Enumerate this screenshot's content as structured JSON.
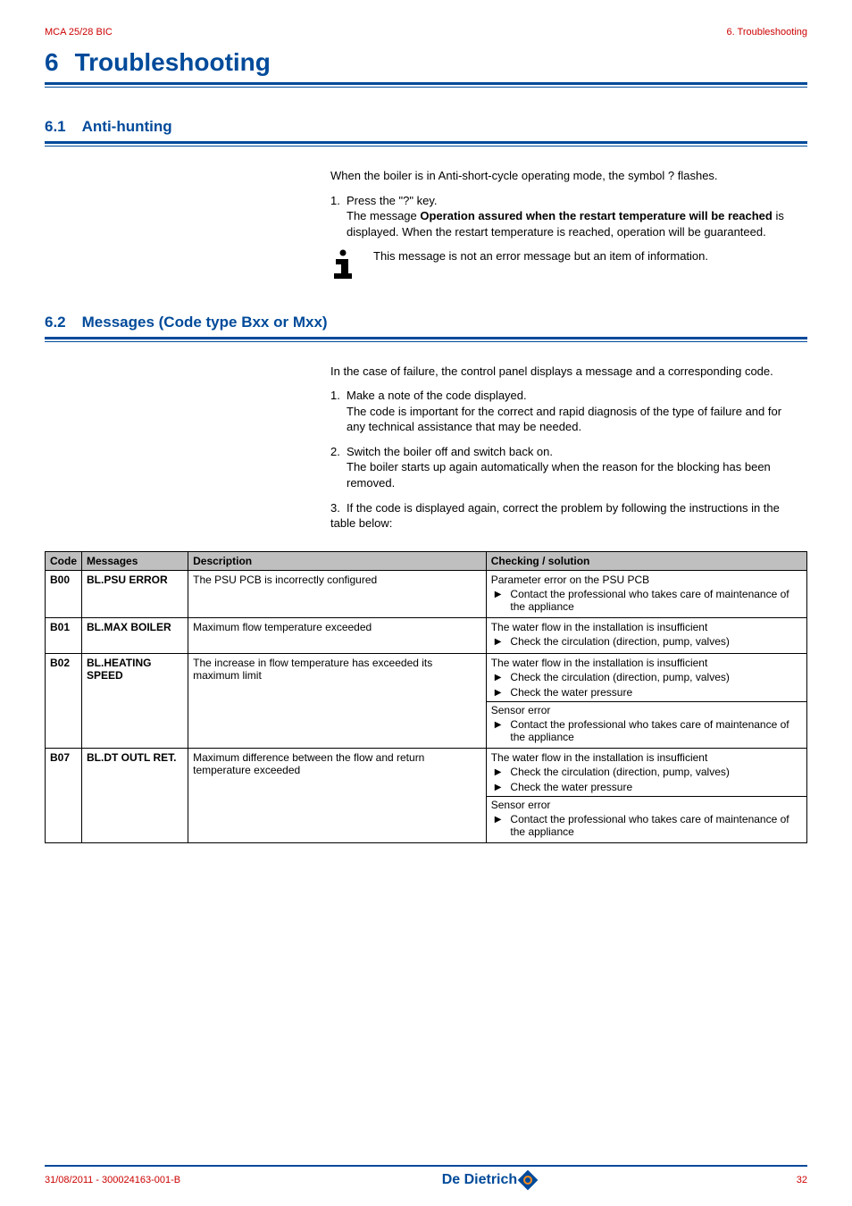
{
  "header": {
    "left": "MCA 25/28 BIC",
    "right": "6.  Troubleshooting"
  },
  "chapter": {
    "number": "6",
    "title": "Troubleshooting"
  },
  "s61": {
    "number": "6.1",
    "title": "Anti-hunting",
    "intro": "When the boiler is in Anti-short-cycle operating mode, the symbol ? flashes.",
    "step1_lead": "1.",
    "step1_first": "Press the \"?\" key.",
    "step1_rest_a": "The message ",
    "step1_rest_b": "Operation assured when the restart temperature will be reached",
    "step1_rest_c": " is displayed. When the restart temperature is reached, operation will be guaranteed.",
    "info": "This message is not an error message but an item of information."
  },
  "s62": {
    "number": "6.2",
    "title": "Messages (Code type Bxx or Mxx)",
    "intro": "In the case of failure, the control panel displays a message and a corresponding code.",
    "step1_lead": "1.",
    "step1_first": "Make a note of the code displayed.",
    "step1_cont": "The code is important for the correct and rapid diagnosis of the type of failure and for any technical assistance that may be needed.",
    "step2_lead": "2.",
    "step2_first": "Switch the boiler off and switch back on.",
    "step2_cont": "The boiler starts up again automatically when the reason for the blocking has been removed.",
    "step3_lead": "3.",
    "step3_first": "If the code is displayed again, correct the problem by following the instructions in the table below:"
  },
  "table": {
    "headers": {
      "code": "Code",
      "messages": "Messages",
      "description": "Description",
      "solution": "Checking / solution"
    },
    "b00": {
      "code": "B00",
      "msg": "BL.PSU ERROR",
      "desc": "The PSU PCB is incorrectly configured",
      "sol_title": "Parameter error on the PSU PCB",
      "sol_sub1": "Contact the professional who takes care of maintenance of the appliance"
    },
    "b01": {
      "code": "B01",
      "msg": "BL.MAX BOILER",
      "desc": "Maximum flow temperature exceeded",
      "sol_title": "The water flow in the installation is insufficient",
      "sol_sub1": "Check the circulation (direction, pump, valves)"
    },
    "b02": {
      "code": "B02",
      "msg": "BL.HEATING SPEED",
      "desc": "The increase in flow temperature has exceeded its maximum limit",
      "sol_titleA": "The water flow in the installation is insufficient",
      "sol_subA1": "Check the circulation (direction, pump, valves)",
      "sol_subA2": "Check the water pressure",
      "sol_titleB": "Sensor error",
      "sol_subB1": "Contact the professional who takes care of maintenance of the appliance"
    },
    "b07": {
      "code": "B07",
      "msg": "BL.DT OUTL RET.",
      "desc": "Maximum difference between the flow and return temperature exceeded",
      "sol_titleA": "The water flow in the installation is insufficient",
      "sol_subA1": "Check the circulation (direction, pump, valves)",
      "sol_subA2": "Check the water pressure",
      "sol_titleB": "Sensor error",
      "sol_subB1": "Contact the professional who takes care of maintenance of the appliance"
    }
  },
  "footer": {
    "left": "31/08/2011  - 300024163-001-B",
    "brand": "De Dietrich",
    "page": "32"
  }
}
